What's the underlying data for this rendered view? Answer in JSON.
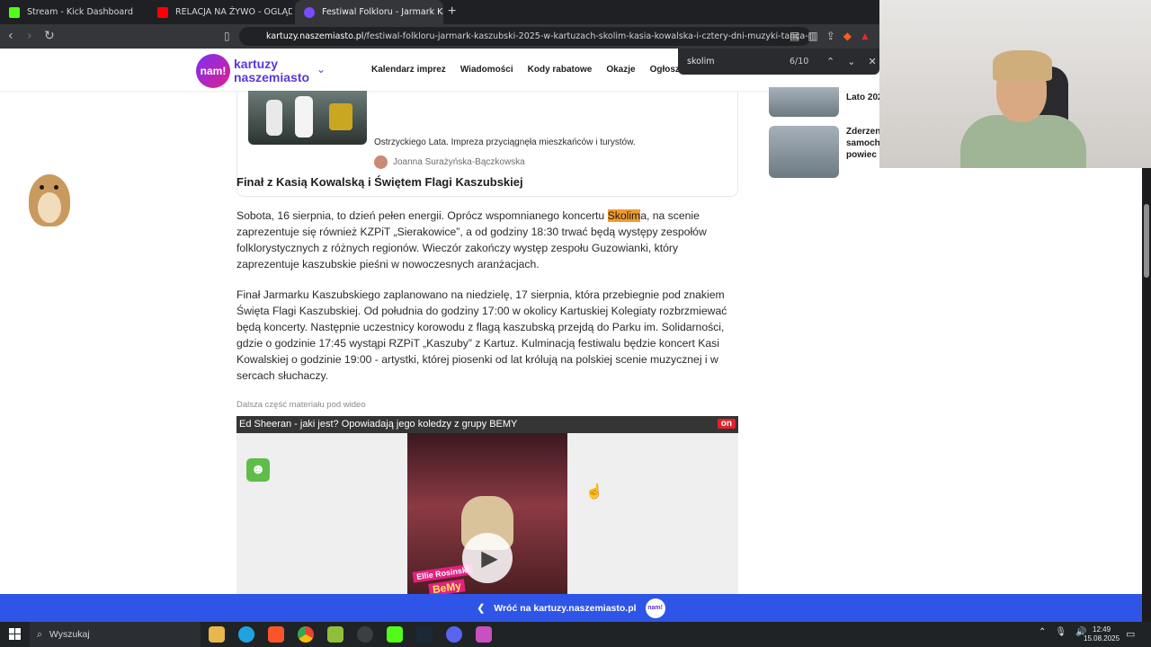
{
  "browser": {
    "tabs": [
      {
        "label": "Stream - Kick Dashboard",
        "color": "#53fc18"
      },
      {
        "label": "RELACJA NA ŻYWO - OGLĄDAJ",
        "color": "#ff0000"
      },
      {
        "label": "Festiwal Folkloru - Jarmark Kaszu",
        "color": "#7b4bff"
      }
    ],
    "url_domain": "kartuzy.naszemiasto.pl",
    "url_path": "/festiwal-folkloru-jarmark-kaszubski-2025-w-kartuzach-skolim-kasia-kowalska-i-cztery-dni-muzyki-tanca-oraz-trad..."
  },
  "find": {
    "query": "skolim",
    "count": "6/10"
  },
  "site": {
    "logo_badge": "nam!",
    "logo_line1": "kartuzy",
    "logo_line2": "naszemiasto",
    "nav": [
      "Kalendarz imprez",
      "Wiadomości",
      "Kody rabatowe",
      "Okazje",
      "Ogłoszenia"
    ]
  },
  "card": {
    "text": "Ostrzyckiego Lata. Impreza przyciągnęła mieszkańców i turystów.",
    "author": "Joanna Surażyńska-Bączkowska"
  },
  "article": {
    "heading": "Finał z Kasią Kowalską i Świętem Flagi Kaszubskiej",
    "p1_before": "Sobota, 16 sierpnia, to dzień pełen energii. Oprócz wspomnianego koncertu ",
    "p1_highlight": "Skolim",
    "p1_after": "a, na scenie zaprezentuje się również KZPiT „Sierakowice”, a od godziny 18:30 trwać będą występy zespołów folklorystycznych z różnych regionów. Wieczór zakończy występ zespołu Guzowianki, który zaprezentuje kaszubskie pieśni w nowoczesnych aranżacjach.",
    "p2": "Finał Jarmarku Kaszubskiego zaplanowano na niedzielę, 17 sierpnia, która przebiegnie pod znakiem Święta Flagi Kaszubskiej. Od południa do godziny 17:00 w okolicy Kartuskiej Kolegiaty rozbrzmiewać będą koncerty. Następnie uczestnicy korowodu z flagą kaszubską przejdą do Parku im. Solidarności, gdzie o godzinie 17:45 wystąpi RZPiT „Kaszuby” z Kartuz. Kulminacją festiwalu będzie koncert Kasi Kowalskiej o godzinie 19:00 - artystki, której piosenki od lat królują na polskiej scenie muzycznej i w sercach słuchaczy.",
    "video_note": "Dalsza część materiału pod wideo"
  },
  "video": {
    "title": "Ed Sheeran - jaki jest? Opowiadają jego koledzy z grupy BEMY",
    "badge": "on",
    "tag1": "Ellie Rosinski",
    "tag2": "BeMy"
  },
  "sidebar": [
    {
      "title": "Lato 202"
    },
    {
      "title": "Zderzen samoch powiec"
    }
  ],
  "return_bar": {
    "label": "Wróć na kartuzy.naszemiasto.pl",
    "badge": "nam!"
  },
  "taskbar": {
    "search_placeholder": "Wyszukaj",
    "time": "12:49",
    "date": "15.08.2025"
  }
}
